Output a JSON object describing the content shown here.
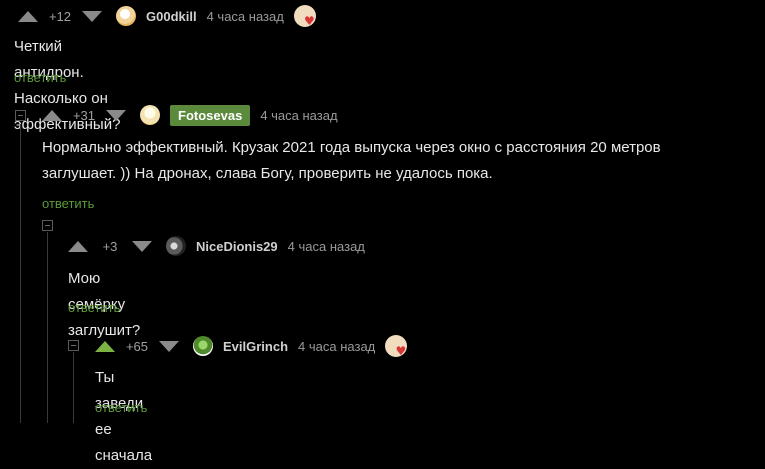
{
  "comments": [
    {
      "rating": "+12",
      "username": "G00dkill",
      "time": "4 часа назад",
      "text": "Четкий антидрон. Насколько он эффективный?",
      "reply_label": "ответить"
    },
    {
      "rating": "+31",
      "username": "Fotosevas",
      "time": "4 часа назад",
      "text": "Нормально эффективный. Крузак 2021 года выпуска через окно с расстояния 20 метров заглушает. )) На дронах, слава Богу, проверить не удалось пока.",
      "reply_label": "ответить"
    },
    {
      "rating": "+3",
      "username": "NiceDionis29",
      "time": "4 часа назад",
      "text": "Мою семёрку заглушит?",
      "reply_label": "ответить"
    },
    {
      "rating": "+65",
      "username": "EvilGrinch",
      "time": "4 часа назад",
      "text": "Ты заведи ее сначала",
      "reply_label": "ответить"
    }
  ],
  "icons": {
    "upvote": "arrow-up-icon",
    "downvote": "arrow-down-icon",
    "collapse": "collapse-minus-icon",
    "award": "heart-award-icon"
  },
  "colors": {
    "background": "#000000",
    "text": "#e8e8e8",
    "meta": "#9a9a9a",
    "reply_link": "#5b9b3a",
    "badge": "#5b8a3c",
    "upvoted_arrow": "#7cb342"
  }
}
